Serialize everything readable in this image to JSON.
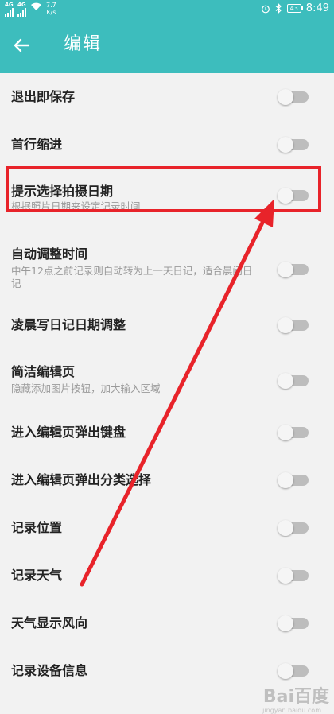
{
  "status_bar": {
    "sim1_label": "4G",
    "sim2_label": "4G",
    "net_speed": "7.7",
    "net_unit": "K/s",
    "battery": "43",
    "time": "8:49",
    "icons": [
      "alarm-icon",
      "bluetooth-icon",
      "wifi-icon",
      "signal-icon",
      "battery-icon"
    ]
  },
  "header": {
    "title": "编辑",
    "back_icon": "arrow-left-icon",
    "background_color": "#3dbdbd"
  },
  "settings": [
    {
      "title": "退出即保存",
      "subtitle": "",
      "enabled": false
    },
    {
      "title": "首行缩进",
      "subtitle": "",
      "enabled": false
    },
    {
      "title": "提示选择拍摄日期",
      "subtitle": "根据照片日期来设定记录时间",
      "enabled": false
    },
    {
      "title": "自动调整时间",
      "subtitle": "中午12点之前记录则自动转为上一天日记，适合晨间日记",
      "enabled": false
    },
    {
      "title": "凌晨写日记日期调整",
      "subtitle": "",
      "enabled": false
    },
    {
      "title": "简洁编辑页",
      "subtitle": "隐藏添加图片按钮，加大输入区域",
      "enabled": false
    },
    {
      "title": "进入编辑页弹出键盘",
      "subtitle": "",
      "enabled": false
    },
    {
      "title": "进入编辑页弹出分类选择",
      "subtitle": "",
      "enabled": false
    },
    {
      "title": "记录位置",
      "subtitle": "",
      "enabled": false
    },
    {
      "title": "记录天气",
      "subtitle": "",
      "enabled": false
    },
    {
      "title": "天气显示风向",
      "subtitle": "",
      "enabled": false
    },
    {
      "title": "记录设备信息",
      "subtitle": "",
      "enabled": false
    }
  ],
  "annotation": {
    "highlight_color": "#e8232a",
    "highlighted_item": "提示选择拍摄日期"
  },
  "watermark": {
    "text": "Bai百度",
    "sub": "jingyan.baidu.com"
  }
}
